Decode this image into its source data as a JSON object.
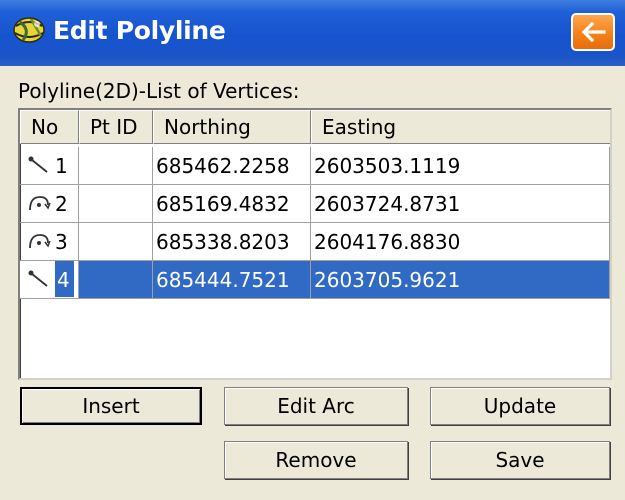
{
  "window": {
    "title": "Edit Polyline",
    "back_icon": "arrow-left-icon",
    "app_icon": "surveyor-globe-icon"
  },
  "list": {
    "label": "Polyline(2D)-List of Vertices:",
    "columns": [
      "No",
      "Pt ID",
      "Northing",
      "Easting"
    ],
    "rows": [
      {
        "icon": "line-segment-icon",
        "no": "1",
        "pt_id": "",
        "northing": "685462.2258",
        "easting": "2603503.1119",
        "selected": false
      },
      {
        "icon": "arc-segment-icon",
        "no": "2",
        "pt_id": "",
        "northing": "685169.4832",
        "easting": "2603724.8731",
        "selected": false
      },
      {
        "icon": "arc-segment-icon",
        "no": "3",
        "pt_id": "",
        "northing": "685338.8203",
        "easting": "2604176.8830",
        "selected": false
      },
      {
        "icon": "line-segment-icon",
        "no": "4",
        "pt_id": "",
        "northing": "685444.7521",
        "easting": "2603705.9621",
        "selected": true
      }
    ]
  },
  "buttons": {
    "insert": "Insert",
    "edit_arc": "Edit Arc",
    "update": "Update",
    "remove": "Remove",
    "save": "Save"
  },
  "colors": {
    "titlebar": "#1654cf",
    "back_button": "#f57f17",
    "selection": "#316ac5",
    "dialog_bg": "#ece9d8"
  }
}
